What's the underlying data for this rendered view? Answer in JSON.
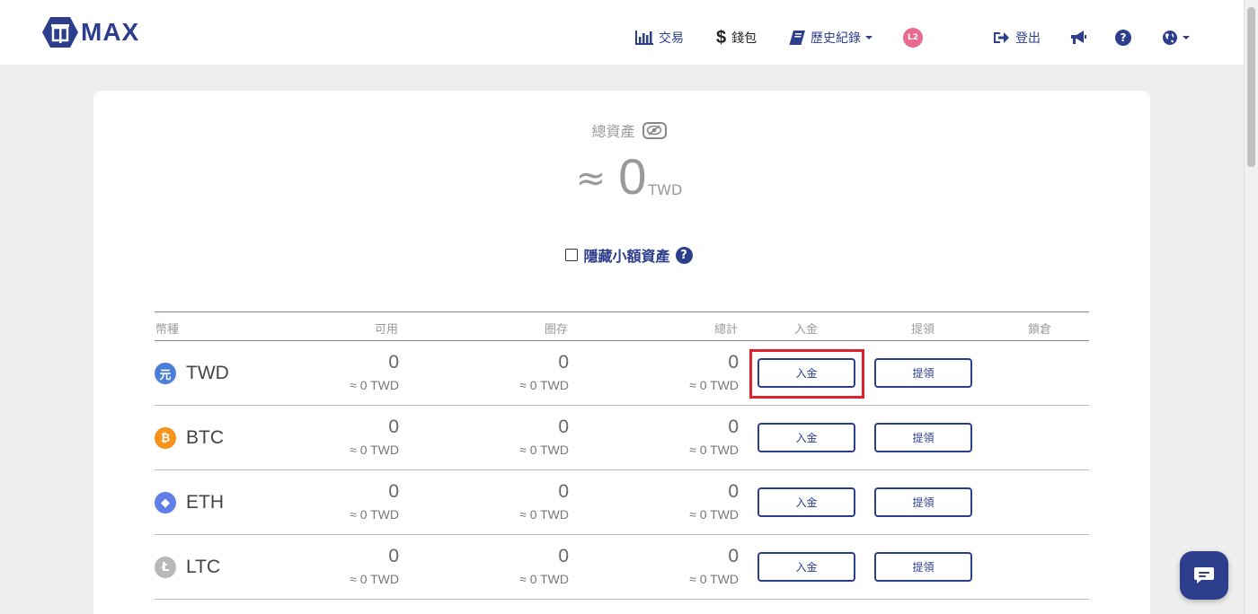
{
  "header": {
    "logo_text": "MAX",
    "nav": {
      "trade": "交易",
      "wallet": "錢包",
      "history": "歷史紀錄",
      "level_badge": "L2",
      "logout": "登出"
    }
  },
  "summary": {
    "total_assets_label": "總資產",
    "approx_symbol": "≈",
    "total_value": "0",
    "currency": "TWD",
    "hide_small_label": "隱藏小額資產",
    "help_symbol": "?"
  },
  "table": {
    "headers": {
      "currency": "幣種",
      "available": "可用",
      "locked": "圈存",
      "total": "總計",
      "deposit": "入金",
      "withdraw": "提領",
      "lock": "鎖倉"
    },
    "rows": [
      {
        "symbol": "TWD",
        "icon": "twd-icon",
        "icon_glyph": "元",
        "icon_color": "#4a7fd8",
        "available": "0",
        "available_twd": "≈ 0 TWD",
        "locked": "0",
        "locked_twd": "≈ 0 TWD",
        "total": "0",
        "total_twd": "≈ 0 TWD",
        "deposit_label": "入金",
        "withdraw_label": "提領"
      },
      {
        "symbol": "BTC",
        "icon": "btc-icon",
        "icon_glyph": "₿",
        "icon_color": "#f7931a",
        "available": "0",
        "available_twd": "≈ 0 TWD",
        "locked": "0",
        "locked_twd": "≈ 0 TWD",
        "total": "0",
        "total_twd": "≈ 0 TWD",
        "deposit_label": "入金",
        "withdraw_label": "提領"
      },
      {
        "symbol": "ETH",
        "icon": "eth-icon",
        "icon_glyph": "◆",
        "icon_color": "#627eea",
        "available": "0",
        "available_twd": "≈ 0 TWD",
        "locked": "0",
        "locked_twd": "≈ 0 TWD",
        "total": "0",
        "total_twd": "≈ 0 TWD",
        "deposit_label": "入金",
        "withdraw_label": "提領"
      },
      {
        "symbol": "LTC",
        "icon": "ltc-icon",
        "icon_glyph": "Ł",
        "icon_color": "#b8b8b8",
        "available": "0",
        "available_twd": "≈ 0 TWD",
        "locked": "0",
        "locked_twd": "≈ 0 TWD",
        "total": "0",
        "total_twd": "≈ 0 TWD",
        "deposit_label": "入金",
        "withdraw_label": "提領"
      }
    ]
  },
  "colors": {
    "brand": "#2d3e8c",
    "highlight": "#e0202a"
  }
}
